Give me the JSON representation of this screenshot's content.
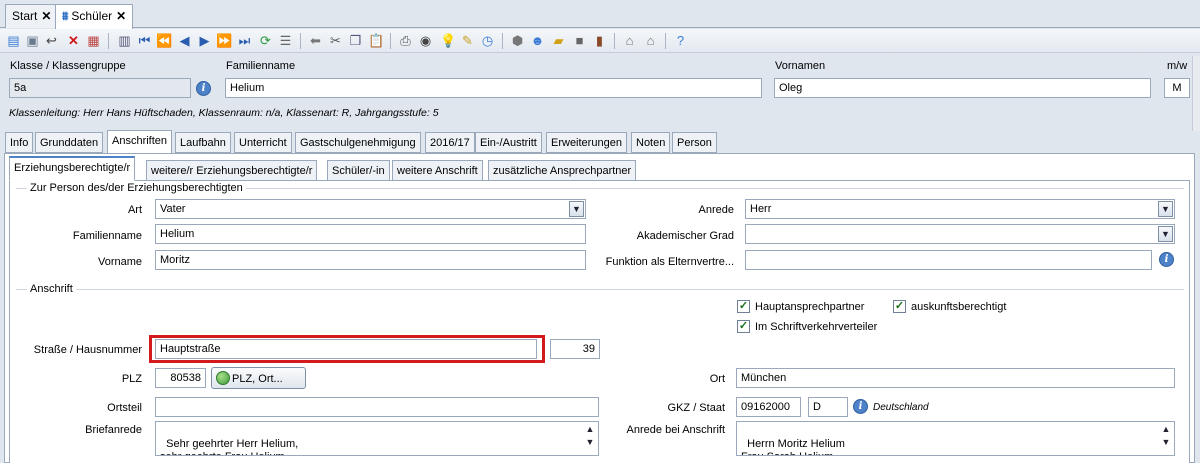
{
  "window_tabs": [
    {
      "label": "Start",
      "close": "✕"
    },
    {
      "label": "Schüler",
      "close": "✕"
    }
  ],
  "toolbar": {
    "icons": [
      "new-record-icon",
      "save-icon",
      "undo-icon",
      "delete-icon",
      "print-record-icon",
      "copy-record-icon",
      "first-icon",
      "prev-page-icon",
      "prev-icon",
      "next-icon",
      "next-page-icon",
      "last-icon",
      "refresh-icon",
      "list-icon",
      "back-arrow-icon",
      "cut-icon",
      "copy-icon",
      "paste-icon",
      "print-icon",
      "preview-icon",
      "idea-icon",
      "broom-icon",
      "clock-icon",
      "package-icon",
      "user-icon",
      "folder-arrow-icon",
      "square-icon",
      "report-icon",
      "home-icon",
      "home-2-icon",
      "help-icon"
    ]
  },
  "header": {
    "klasse_label": "Klasse / Klassengruppe",
    "klasse_value": "5a",
    "familienname_label": "Familienname",
    "familienname_value": "Helium",
    "vornamen_label": "Vornamen",
    "vornamen_value": "Oleg",
    "mw_label": "m/w",
    "mw_value": "M",
    "klassenleitung": "Klassenleitung: Herr Hans Hüftschaden, Klassenraum: n/a, Klassenart: R, Jahrgangsstufe: 5"
  },
  "main_tabs": [
    "Info",
    "Grunddaten",
    "Anschriften",
    "Laufbahn",
    "Unterricht",
    "Gastschulgenehmigung",
    "2016/17",
    "Ein-/Austritt",
    "Erweiterungen",
    "Noten",
    "Person"
  ],
  "sub_tabs": [
    "Erziehungsberechtigte/r",
    "weitere/r Erziehungsberechtigte/r",
    "Schüler/-in",
    "weitere Anschrift",
    "zusätzliche Ansprechpartner"
  ],
  "person": {
    "group_title": "Zur Person des/der Erziehungsberechtigten",
    "art_label": "Art",
    "art_value": "Vater",
    "familienname_label": "Familienname",
    "familienname_value": "Helium",
    "vorname_label": "Vorname",
    "vorname_value": "Moritz",
    "anrede_label": "Anrede",
    "anrede_value": "Herr",
    "grad_label": "Akademischer Grad",
    "grad_value": "",
    "funktion_label": "Funktion als Elternvertre...",
    "funktion_value": ""
  },
  "anschrift": {
    "group_title": "Anschrift",
    "cb_haupt": "Hauptansprechpartner",
    "cb_auskunft": "auskunftsberechtigt",
    "cb_schrift": "Im Schriftverkehrverteiler",
    "strasse_label": "Straße / Hausnummer",
    "strasse_value": "Hauptstraße",
    "hausnummer_value": "39",
    "plz_label": "PLZ",
    "plz_value": "80538",
    "plz_button": "PLZ, Ort...",
    "ort_label": "Ort",
    "ort_value": "München",
    "ortsteil_label": "Ortsteil",
    "ortsteil_value": "",
    "gkz_label": "GKZ / Staat",
    "gkz_value": "09162000",
    "staat_value": "D",
    "staat_name": "Deutschland",
    "briefanrede_label": "Briefanrede",
    "briefanrede_value": "Sehr geehrter Herr Helium,\nsehr geehrte Frau Helium",
    "anrede_anschrift_label": "Anrede bei Anschrift",
    "anrede_anschrift_value": "Herrn Moritz Helium\nFrau Sarah Helium"
  },
  "colors": {
    "highlight": "#d2191c",
    "accent": "#4d82c8"
  }
}
